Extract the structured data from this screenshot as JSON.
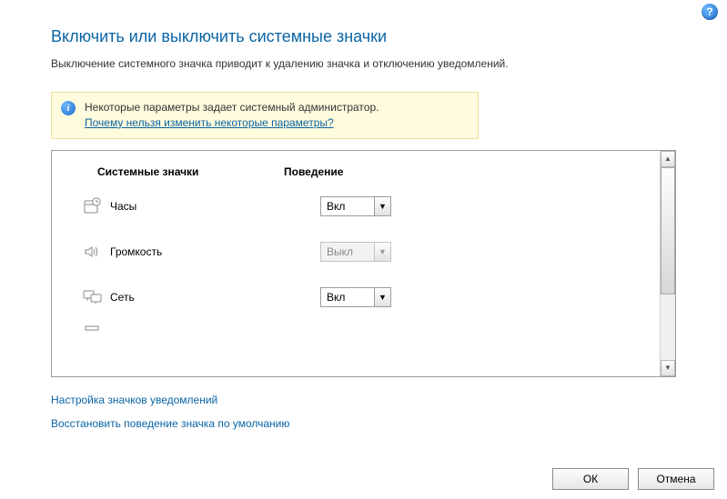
{
  "help_tooltip": "?",
  "heading": "Включить или выключить системные значки",
  "subtitle": "Выключение системного значка приводит к удалению значка и отключению уведомлений.",
  "info": {
    "message": "Некоторые параметры задает системный администратор.",
    "link": "Почему нельзя изменить некоторые параметры?"
  },
  "columns": {
    "icons": "Системные значки",
    "behavior": "Поведение"
  },
  "rows": [
    {
      "icon": "clock-icon",
      "label": "Часы",
      "value": "Вкл",
      "enabled": true
    },
    {
      "icon": "volume-icon",
      "label": "Громкость",
      "value": "Выкл",
      "enabled": false
    },
    {
      "icon": "network-icon",
      "label": "Сеть",
      "value": "Вкл",
      "enabled": true
    }
  ],
  "links": {
    "customize": "Настройка значков уведомлений",
    "restore": "Восстановить поведение значка по умолчанию"
  },
  "buttons": {
    "ok": "ОК",
    "cancel": "Отмена"
  }
}
